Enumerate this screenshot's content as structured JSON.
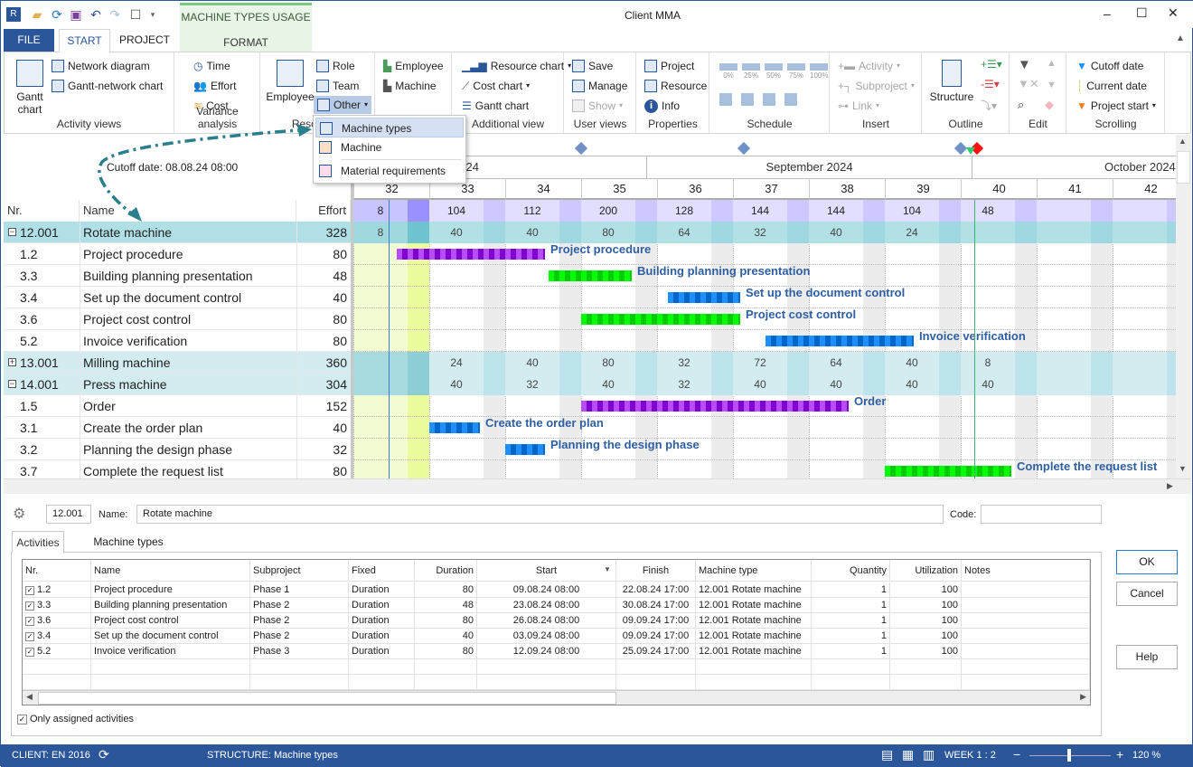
{
  "app": {
    "title": "Client MMA",
    "context_tab_group": "MACHINE TYPES USAGE",
    "context_tab": "FORMAT"
  },
  "tabs": [
    {
      "label": "FILE"
    },
    {
      "label": "START"
    },
    {
      "label": "PROJECT"
    }
  ],
  "ribbon": {
    "activity_views": {
      "label": "Activity views",
      "gantt": "Gantt chart",
      "network": "Network diagram",
      "gantt_network": "Gantt-network chart"
    },
    "variance": {
      "label": "Variance analysis",
      "time": "Time",
      "effort": "Effort",
      "cost": "Cost"
    },
    "resources": {
      "label": "Resources",
      "employee": "Employee",
      "role": "Role",
      "team": "Team",
      "other": "Other"
    },
    "res2": {
      "employee": "Employee",
      "machine": "Machine"
    },
    "additional": {
      "label": "Additional view",
      "resource_chart": "Resource chart",
      "cost_chart": "Cost chart",
      "gantt_chart": "Gantt chart"
    },
    "user_views": {
      "label": "User views",
      "save": "Save",
      "manage": "Manage",
      "show": "Show"
    },
    "properties": {
      "label": "Properties",
      "project": "Project",
      "resource": "Resource",
      "info": "Info"
    },
    "schedule": {
      "label": "Schedule",
      "percents": [
        "0%",
        "25%",
        "50%",
        "75%",
        "100%"
      ]
    },
    "insert": {
      "label": "Insert",
      "activity": "Activity",
      "subproject": "Subproject",
      "link": "Link"
    },
    "outline": {
      "label": "Outline",
      "structure": "Structure"
    },
    "edit": {
      "label": "Edit"
    },
    "scrolling": {
      "label": "Scrolling",
      "cutoff": "Cutoff date",
      "current": "Current date",
      "project_start": "Project start"
    }
  },
  "other_menu": [
    {
      "label": "Machine types",
      "highlighted": true
    },
    {
      "label": "Machine"
    },
    {
      "label": "Material requirements"
    }
  ],
  "gantt": {
    "cutoff_label": "Cutoff date: 08.08.24 08:00",
    "months": [
      {
        "label": "August 2024"
      },
      {
        "label": "September 2024"
      },
      {
        "label": "October 2024"
      }
    ],
    "weeks": [
      32,
      33,
      34,
      35,
      36,
      37,
      38,
      39,
      40,
      41,
      42
    ],
    "columns": {
      "nr": "Nr.",
      "name": "Name",
      "effort": "Effort"
    },
    "total_load": [
      8,
      104,
      112,
      200,
      128,
      144,
      144,
      104,
      48
    ],
    "cutoff_date": "2024-08-08",
    "current_date": "2024-10-01",
    "milestones": [
      "2024-08-26",
      "2024-09-10",
      "2024-09-30",
      "2024-10-01"
    ],
    "rows": [
      {
        "nr": "12.001",
        "name": "Rotate machine",
        "effort": "328",
        "type": "group",
        "toggle": "minus",
        "load": [
          8,
          40,
          40,
          80,
          64,
          32,
          40,
          24
        ]
      },
      {
        "nr": "1.2",
        "name": "Project procedure",
        "effort": "80",
        "type": "task",
        "bar": {
          "start": "2024-08-09",
          "finish": "2024-08-22",
          "color": "#b84dff",
          "dark": "#8000d0"
        }
      },
      {
        "nr": "3.3",
        "name": "Building planning presentation",
        "effort": "48",
        "type": "task",
        "bar": {
          "start": "2024-08-23",
          "finish": "2024-08-30",
          "color": "#00ff00",
          "dark": "#00cc00"
        }
      },
      {
        "nr": "3.4",
        "name": "Set up the document control",
        "effort": "40",
        "type": "task",
        "bar": {
          "start": "2024-09-03",
          "finish": "2024-09-09",
          "color": "#1e90ff",
          "dark": "#0066cc"
        }
      },
      {
        "nr": "3.6",
        "name": "Project cost control",
        "effort": "80",
        "type": "task",
        "bar": {
          "start": "2024-08-26",
          "finish": "2024-09-09",
          "color": "#00ff00",
          "dark": "#00cc00"
        }
      },
      {
        "nr": "5.2",
        "name": "Invoice verification",
        "effort": "80",
        "type": "task",
        "bar": {
          "start": "2024-09-12",
          "finish": "2024-09-25",
          "color": "#1e90ff",
          "dark": "#0066cc"
        }
      },
      {
        "nr": "13.001",
        "name": "Milling machine",
        "effort": "360",
        "type": "group2",
        "toggle": "plus",
        "load": [
          null,
          24,
          40,
          80,
          32,
          72,
          64,
          40,
          8
        ]
      },
      {
        "nr": "14.001",
        "name": "Press machine",
        "effort": "304",
        "type": "group2",
        "toggle": "minus",
        "load": [
          null,
          40,
          32,
          40,
          32,
          40,
          40,
          40,
          40
        ]
      },
      {
        "nr": "1.5",
        "name": "Order",
        "effort": "152",
        "type": "task",
        "bar": {
          "start": "2024-08-26",
          "finish": "2024-09-19",
          "color": "#b84dff",
          "dark": "#8000d0"
        }
      },
      {
        "nr": "3.1",
        "name": "Create the order plan",
        "effort": "40",
        "type": "task",
        "bar": {
          "start": "2024-08-12",
          "finish": "2024-08-16",
          "color": "#1e90ff",
          "dark": "#0066cc"
        }
      },
      {
        "nr": "3.2",
        "name": "Planning the design phase",
        "effort": "32",
        "type": "task",
        "bar": {
          "start": "2024-08-19",
          "finish": "2024-08-22",
          "color": "#1e90ff",
          "dark": "#0066cc"
        }
      },
      {
        "nr": "3.7",
        "name": "Complete the request list",
        "effort": "80",
        "type": "task",
        "bar": {
          "start": "2024-09-23",
          "finish": "2024-10-04",
          "color": "#00ff00",
          "dark": "#00cc00"
        }
      }
    ]
  },
  "detail": {
    "id": "12.001",
    "name_label": "Name:",
    "name_value": "Rotate machine",
    "code_label": "Code:",
    "code_value": "",
    "tabs": [
      {
        "label": "Activities",
        "active": true
      },
      {
        "label": "Machine types"
      }
    ],
    "columns": [
      "Nr.",
      "Name",
      "Subproject",
      "Fixed",
      "Duration",
      "Start",
      "Finish",
      "Machine type",
      "Quantity",
      "Utilization",
      "Notes"
    ],
    "rows": [
      {
        "checked": true,
        "nr": "1.2",
        "name": "Project procedure",
        "subproject": "Phase 1",
        "fixed": "Duration",
        "duration": "80",
        "start": "09.08.24 08:00",
        "finish": "22.08.24 17:00",
        "machine_type": "12.001 Rotate machine",
        "quantity": "1",
        "utilization": "100",
        "notes": ""
      },
      {
        "checked": true,
        "nr": "3.3",
        "name": "Building planning presentation",
        "subproject": "Phase 2",
        "fixed": "Duration",
        "duration": "48",
        "start": "23.08.24 08:00",
        "finish": "30.08.24 17:00",
        "machine_type": "12.001 Rotate machine",
        "quantity": "1",
        "utilization": "100",
        "notes": ""
      },
      {
        "checked": true,
        "nr": "3.6",
        "name": "Project cost control",
        "subproject": "Phase 2",
        "fixed": "Duration",
        "duration": "80",
        "start": "26.08.24 08:00",
        "finish": "09.09.24 17:00",
        "machine_type": "12.001 Rotate machine",
        "quantity": "1",
        "utilization": "100",
        "notes": ""
      },
      {
        "checked": true,
        "nr": "3.4",
        "name": "Set up the document control",
        "subproject": "Phase 2",
        "fixed": "Duration",
        "duration": "40",
        "start": "03.09.24 08:00",
        "finish": "09.09.24 17:00",
        "machine_type": "12.001 Rotate machine",
        "quantity": "1",
        "utilization": "100",
        "notes": ""
      },
      {
        "checked": true,
        "nr": "5.2",
        "name": "Invoice verification",
        "subproject": "Phase 3",
        "fixed": "Duration",
        "duration": "80",
        "start": "12.09.24 08:00",
        "finish": "25.09.24 17:00",
        "machine_type": "12.001 Rotate machine",
        "quantity": "1",
        "utilization": "100",
        "notes": ""
      }
    ],
    "only_assigned": "Only assigned activities",
    "ok": "OK",
    "cancel": "Cancel",
    "help": "Help"
  },
  "status": {
    "client": "CLIENT: EN 2016",
    "structure": "STRUCTURE: Machine types",
    "scale": "WEEK 1 : 2",
    "zoom": "120 %",
    "zoom_level": 120
  },
  "colors": {
    "accent": "#2b579a",
    "group_row": "#b0dfe5",
    "total_load": "#e0dcff",
    "cutoff_line": "#3a7fc8",
    "current_line": "#3cb371",
    "label": "#2e5fa3"
  }
}
